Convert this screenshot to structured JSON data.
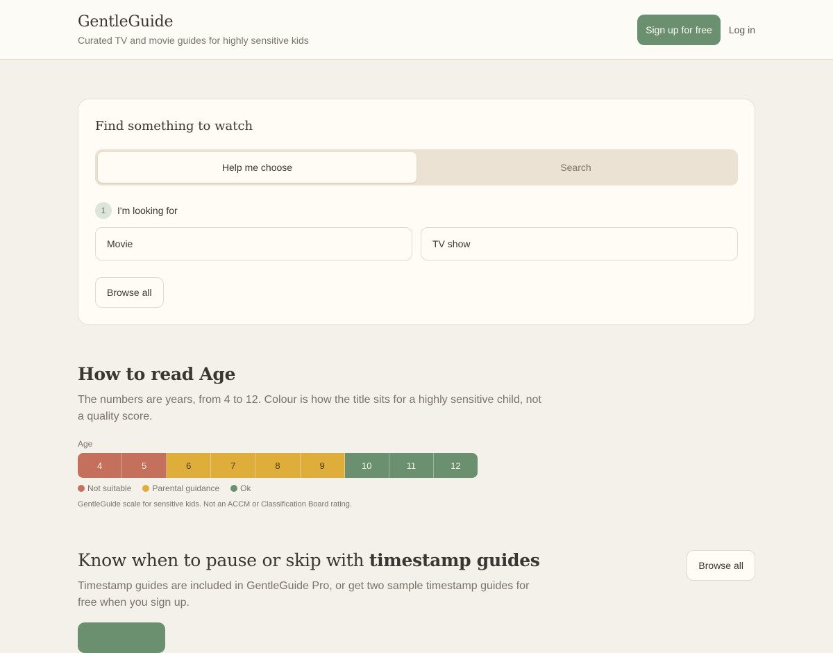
{
  "header": {
    "brand": "GentleGuide",
    "tagline": "Curated TV and movie guides for highly sensitive kids",
    "signup_label": "Sign up for free",
    "login_label": "Log in"
  },
  "finder": {
    "title": "Find something to watch",
    "tabs": [
      {
        "label": "Help me choose",
        "active": true
      },
      {
        "label": "Search",
        "active": false
      }
    ],
    "step": {
      "number": "1",
      "label": "I'm looking for"
    },
    "choices": [
      "Movie",
      "TV show"
    ],
    "browse_label": "Browse all"
  },
  "age": {
    "title": "How to read Age",
    "description": "The numbers are years, from 4 to 12. Colour is how the title sits for a highly sensitive child, not a quality score.",
    "label": "Age",
    "cells": [
      {
        "age": "4",
        "status": "not_suitable"
      },
      {
        "age": "5",
        "status": "not_suitable"
      },
      {
        "age": "6",
        "status": "parental"
      },
      {
        "age": "7",
        "status": "parental"
      },
      {
        "age": "8",
        "status": "parental"
      },
      {
        "age": "9",
        "status": "parental"
      },
      {
        "age": "10",
        "status": "ok"
      },
      {
        "age": "11",
        "status": "ok"
      },
      {
        "age": "12",
        "status": "ok"
      }
    ],
    "legend": [
      {
        "key": "not_suitable",
        "label": "Not suitable",
        "color": "#c4705c"
      },
      {
        "key": "parental",
        "label": "Parental guidance",
        "color": "#dfae3a"
      },
      {
        "key": "ok",
        "label": "Ok",
        "color": "#6b9070"
      }
    ],
    "note": "GentleGuide scale for sensitive kids. Not an ACCM or Classification Board rating."
  },
  "timestamp": {
    "title_plain": "Know when to pause or skip with ",
    "title_bold": "timestamp guides",
    "description": "Timestamp guides are included in GentleGuide Pro, or get two sample timestamp guides for free when you sign up.",
    "browse_label": "Browse all"
  },
  "colors": {
    "accent": "#6b9070",
    "background": "#f4f1ea",
    "surface": "#fefcf4"
  }
}
